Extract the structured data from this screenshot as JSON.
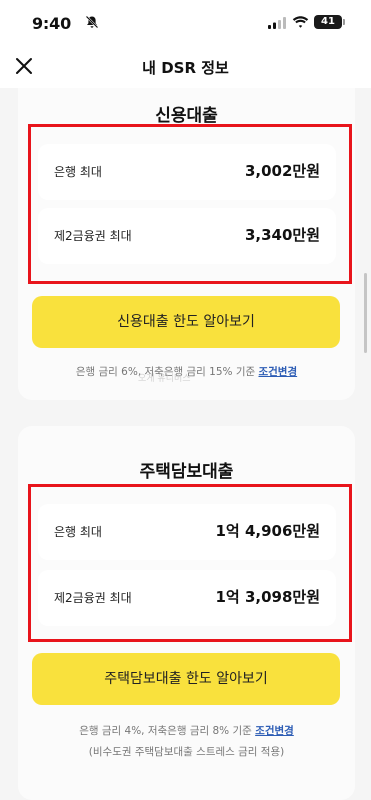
{
  "status_bar": {
    "time": "9:40",
    "battery": "41"
  },
  "header": {
    "title": "내 DSR 정보"
  },
  "credit_loan": {
    "title": "신용대출",
    "rows": [
      {
        "label": "은행 최대",
        "value": "3,002만원"
      },
      {
        "label": "제2금융권 최대",
        "value": "3,340만원"
      }
    ],
    "button_label": "신용대출 한도 알아보기",
    "note_text": "은행 금리 6%, 저축은행 금리 15% 기준",
    "note_link": "조건변경"
  },
  "mortgage_loan": {
    "title": "주택담보대출",
    "rows": [
      {
        "label": "은행 최대",
        "value": "1억 4,906만원"
      },
      {
        "label": "제2금융권 최대",
        "value": "1억 3,098만원"
      }
    ],
    "button_label": "주택담보대출 한도 알아보기",
    "note_text": "은행 금리 4%, 저축은행 금리 8% 기준",
    "note_link": "조건변경",
    "note_sub": "(비수도권 주택담보대출 스트레스 금리 적용)"
  },
  "watermark": "오게 유니버스",
  "colors": {
    "highlight": "#e8141b",
    "button": "#f9e13d",
    "link": "#2d5db5"
  }
}
